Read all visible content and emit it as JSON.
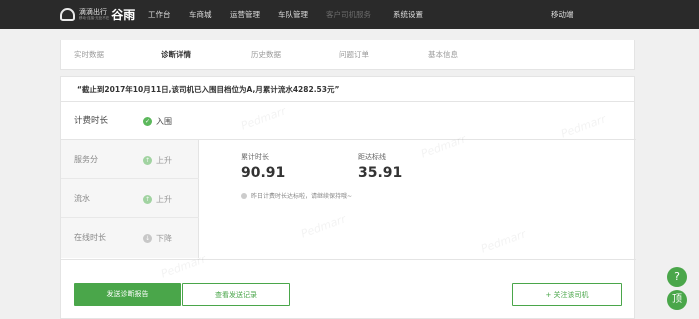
{
  "header": {
    "brand": "滴滴出行",
    "slogan": "移动·连接·无处不在",
    "product": "谷雨",
    "nav": [
      "工作台",
      "车商城",
      "运营管理",
      "车队管理",
      "客户司机服务",
      "系统设置"
    ],
    "active_nav": "客户司机服务",
    "user": "移动端"
  },
  "tabs": [
    "实时数据",
    "诊断详情",
    "历史数据",
    "问题订单",
    "基本信息"
  ],
  "active_tab": "诊断详情",
  "notice": "“截止到2017年10月11日,该司机已入围目档位为A,月累计流水4282.53元”",
  "diagnosis": {
    "main": {
      "label": "计费时长",
      "status": "入围"
    },
    "rows": [
      {
        "label": "服务分",
        "status": "上升"
      },
      {
        "label": "流水",
        "status": "上升"
      },
      {
        "label": "在线时长",
        "status": "下降"
      }
    ],
    "metrics": [
      {
        "label": "累计时长",
        "value": "90.91"
      },
      {
        "label": "距达标线",
        "value": "35.91"
      }
    ],
    "tip": "昨日计费时长达标啦，请继续保持哦~"
  },
  "actions": {
    "send_report": "发送诊断报告",
    "view_records": "查看发送记录",
    "follow_driver": "+ 关注该司机"
  },
  "float": {
    "help": "?",
    "top": "顶"
  },
  "watermark": "Pedmarr",
  "colors": {
    "accent": "#4aa64a",
    "topbar": "#2a2a2a",
    "up": "#5cb85c",
    "down": "#c8c8c8"
  }
}
